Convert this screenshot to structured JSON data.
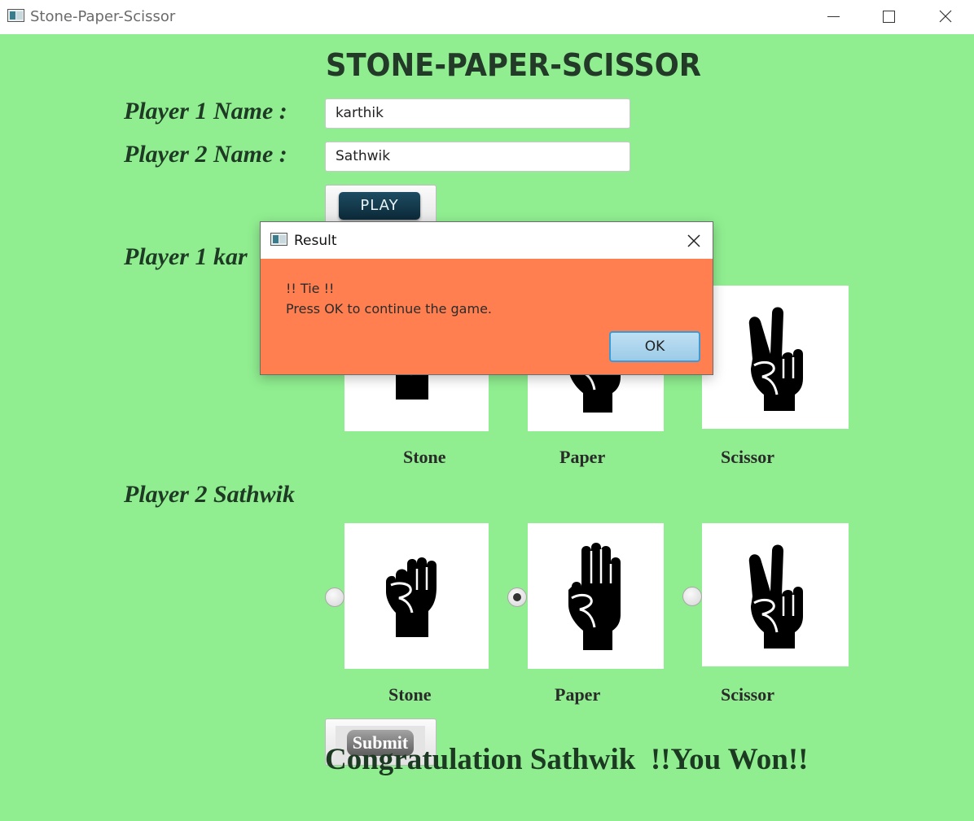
{
  "window": {
    "title": "Stone-Paper-Scissor"
  },
  "header": {
    "title": "STONE-PAPER-SCISSOR"
  },
  "form": {
    "player1_label": "Player 1 Name :",
    "player1_value": "karthik",
    "player2_label": "Player 2 Name :",
    "player2_value": "Sathwik",
    "play_label": "PLAY"
  },
  "player1_section": {
    "label": "Player 1 kar",
    "choices": [
      "Stone",
      "Paper",
      "Scissor"
    ]
  },
  "player2_section": {
    "label": "Player 2 Sathwik",
    "choices": [
      "Stone",
      "Paper",
      "Scissor"
    ],
    "selected": "Paper"
  },
  "submit_label": "Submit",
  "result_message": "Congratulation Sathwik  !!You Won!!",
  "dialog": {
    "title": "Result",
    "line1": "!! Tie !!",
    "line2": "Press OK to continue the game.",
    "ok_label": "OK"
  },
  "colors": {
    "background": "#90ee90",
    "dialog_background": "#ff7f50",
    "heading_text": "#1e3a24"
  },
  "icons": [
    "app-icon",
    "minimize-icon",
    "maximize-icon",
    "close-icon",
    "stone-hand-icon",
    "paper-hand-icon",
    "scissor-hand-icon"
  ]
}
